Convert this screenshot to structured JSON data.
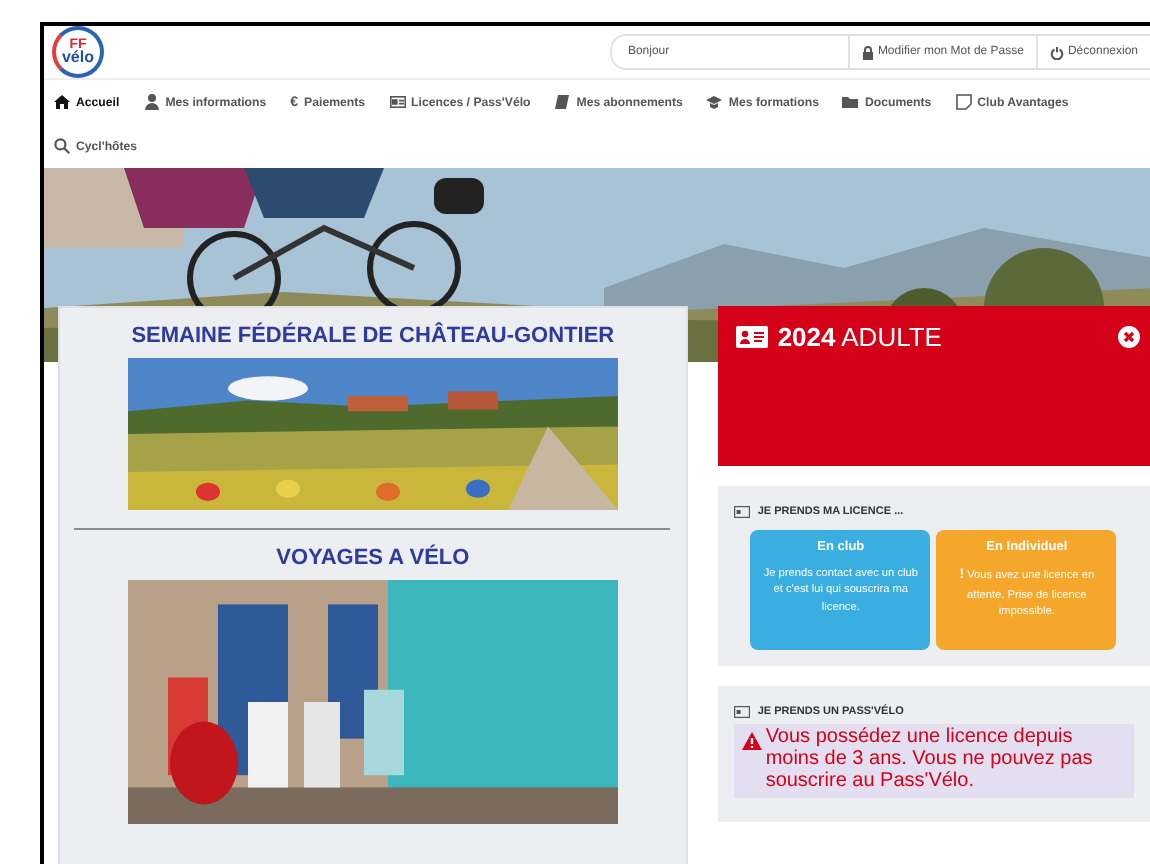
{
  "header": {
    "logo": {
      "line1": "FF",
      "line2": "vélo"
    },
    "greeting": "Bonjour",
    "links": [
      {
        "label": "Modifier mon Mot de Passe"
      },
      {
        "label": "Déconnexion"
      }
    ]
  },
  "nav": [
    {
      "label": "Accueil",
      "selected": true
    },
    {
      "label": "Mes informations",
      "selected": false
    },
    {
      "glyph": "€",
      "label": "Paiements",
      "selected": false
    },
    {
      "label": "Licences / Pass'Vélo",
      "selected": false
    },
    {
      "label": "Mes abonnements",
      "selected": false
    },
    {
      "label": "Mes formations",
      "selected": false
    },
    {
      "label": "Documents",
      "selected": false
    },
    {
      "label": "Club Avantages",
      "selected": false
    },
    {
      "label": "Cycl'hôtes",
      "selected": false
    }
  ],
  "promos": [
    {
      "title": "SEMAINE FÉDÉRALE DE CHÂTEAU-GONTIER"
    },
    {
      "title": "VOYAGES A VÉLO"
    }
  ],
  "licence_card": {
    "year": "2024",
    "category": "ADULTE"
  },
  "licence_panel": {
    "heading": "JE PRENDS MA LICENCE ...",
    "options": [
      {
        "title": "En club",
        "text": "Je prends contact avec un club et c'est lui qui souscrira ma licence.",
        "color": "#3aaee0"
      },
      {
        "title": "En Individuel",
        "text": "Vous avez une licence en attente. Prise de licence impossible.",
        "color": "#f5a72c",
        "mark": "!"
      }
    ]
  },
  "pass_panel": {
    "heading": "JE PRENDS UN PASS'VÉLO",
    "alert": "Vous possédez une licence depuis moins de 3 ans. Vous ne pouvez pas souscrire au Pass'Vélo."
  }
}
